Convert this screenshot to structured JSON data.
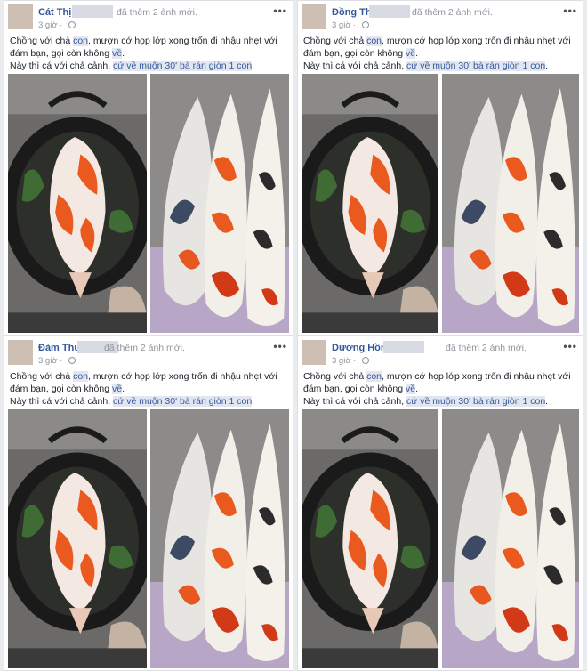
{
  "colors": {
    "link": "#365899",
    "meta": "#90949c",
    "tag_bg": "#e1e6f1",
    "koi_orange": "#e8551c",
    "koi_red": "#d23a17"
  },
  "icons": {
    "more": "more-dots-icon",
    "privacy": "globe-icon"
  },
  "posts": [
    {
      "name": "Cát Thị",
      "action": "đã thêm 2 ảnh mới.",
      "time": "3 giờ ·",
      "more": "•••",
      "text": {
        "p1": "Chồng với chả ",
        "t1": "con",
        "p2": ", mượn cớ họp lớp xong trốn đi nhậu nhẹt với đám bạn, gọi còn không ",
        "t2": "về",
        "p3": ".",
        "p4": "Này thì cá với chả cảnh, ",
        "t3": "cứ về muộn 30' bà rán giòn 1 con",
        "p5": "."
      }
    },
    {
      "name": "Đồng Thị",
      "action": "đã thêm 2 ảnh mới.",
      "time": "3 giờ ·",
      "more": "•••",
      "text": {
        "p1": "Chồng với chả ",
        "t1": "con",
        "p2": ", mượn cớ họp lớp xong trốn đi nhậu nhẹt với đám bạn, gọi còn không ",
        "t2": "về",
        "p3": ".",
        "p4": "Này thì cá với chả cảnh, ",
        "t3": "cứ về muộn 30' bà rán giòn 1 con",
        "p5": "."
      }
    },
    {
      "name": "Đàm Thu",
      "action": "đã thêm 2 ảnh mới.",
      "time": "3 giờ ·",
      "more": "•••",
      "text": {
        "p1": "Chồng với chả ",
        "t1": "con",
        "p2": ", mượn cớ họp lớp xong trốn đi nhậu nhẹt với đám bạn, gọi còn không ",
        "t2": "về",
        "p3": ".",
        "p4": "Này thì cá với chả cảnh, ",
        "t3": "cứ về muộn 30' bà rán giòn 1 con",
        "p5": "."
      }
    },
    {
      "name": "Dương Hồng",
      "action": "đã thêm 2 ảnh mới.",
      "time": "3 giờ ·",
      "more": "•••",
      "text": {
        "p1": "Chồng với chả ",
        "t1": "con",
        "p2": ", mượn cớ họp lớp xong trốn đi nhậu nhẹt với đám bạn, gọi còn không ",
        "t2": "về",
        "p3": ".",
        "p4": "Này thì cá với chả cảnh, ",
        "t3": "cứ về muộn 30' bà rán giòn 1 con",
        "p5": "."
      }
    }
  ]
}
